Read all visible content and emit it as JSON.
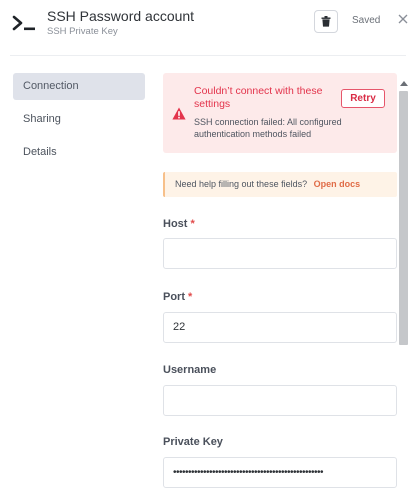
{
  "header": {
    "title": "SSH Password account",
    "subtitle": "SSH Private Key",
    "saved_label": "Saved"
  },
  "sidebar": {
    "items": [
      {
        "label": "Connection"
      },
      {
        "label": "Sharing"
      },
      {
        "label": "Details"
      }
    ]
  },
  "alert": {
    "title": "Couldn’t connect with these settings",
    "message": "SSH connection failed: All configured authentication methods failed",
    "retry_label": "Retry"
  },
  "hint": {
    "text": "Need help filling out these fields?",
    "link": "Open docs"
  },
  "fields": {
    "host": {
      "label": "Host",
      "required": "*",
      "value": ""
    },
    "port": {
      "label": "Port",
      "required": "*",
      "value": "22"
    },
    "username": {
      "label": "Username",
      "value": ""
    },
    "private_key": {
      "label": "Private Key",
      "value": "••••••••••••••••••••••••••••••••••••••••••••••••••"
    }
  },
  "colors": {
    "accent": "#e14a4a",
    "alert_bg": "#fdeaea",
    "hint_bg": "#fef3e7",
    "link": "#e06c47",
    "active_nav": "#dfe2ea"
  },
  "icons": {
    "app": "terminal-icon",
    "trash": "trash-icon",
    "close": "close-icon",
    "warning": "warning-icon"
  }
}
